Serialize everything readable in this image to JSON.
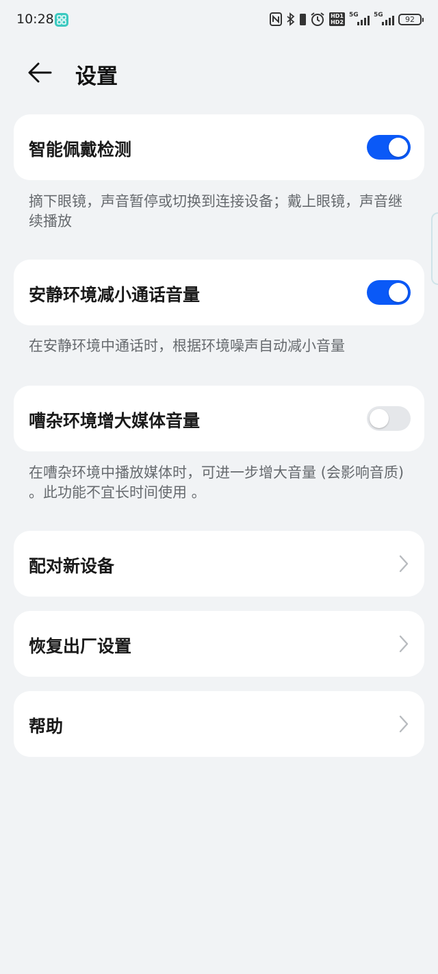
{
  "status_bar": {
    "time": "10:28",
    "hd_top": "HD1",
    "hd_bottom": "HD2",
    "signal1_label": "5G",
    "signal2_label": "5G",
    "battery": "92"
  },
  "header": {
    "title": "设置"
  },
  "settings": {
    "smart_wear": {
      "label": "智能佩戴检测",
      "enabled": true,
      "description": "摘下眼镜，声音暂停或切换到连接设备；戴上眼镜，声音继续播放"
    },
    "quiet_reduce": {
      "label": "安静环境减小通话音量",
      "enabled": true,
      "description": "在安静环境中通话时，根据环境噪声自动减小音量"
    },
    "noisy_boost": {
      "label": "嘈杂环境增大媒体音量",
      "enabled": false,
      "description": "在嘈杂环境中播放媒体时，可进一步增大音量 (会影响音质) 。此功能不宜长时间使用 。"
    }
  },
  "menu": {
    "pair": "配对新设备",
    "reset": "恢复出厂设置",
    "help": "帮助"
  },
  "colors": {
    "accent": "#0a59f7",
    "background": "#f1f3f5",
    "card": "#ffffff"
  }
}
